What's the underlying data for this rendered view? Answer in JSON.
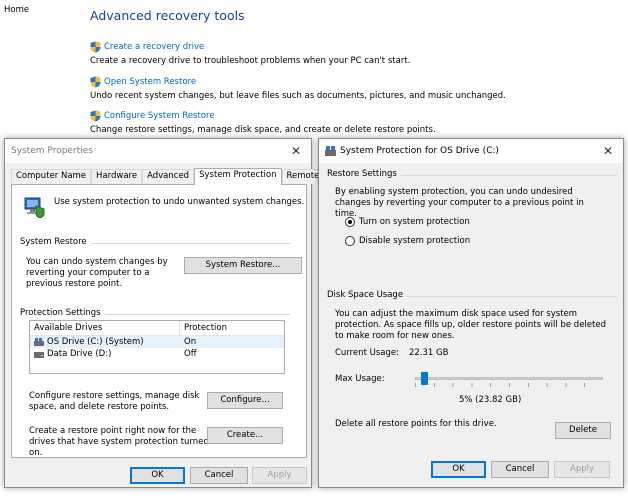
{
  "control_panel": {
    "home": "Home",
    "title": "Advanced recovery tools",
    "items": [
      {
        "link": "Create a recovery drive",
        "desc": "Create a recovery drive to troubleshoot problems when your PC can't start."
      },
      {
        "link": "Open System Restore",
        "desc": "Undo recent system changes, but leave files such as documents, pictures, and music unchanged."
      },
      {
        "link": "Configure System Restore",
        "desc": "Change restore settings, manage disk space, and create or delete restore points."
      }
    ]
  },
  "system_properties": {
    "title": "System Properties",
    "tabs": [
      "Computer Name",
      "Hardware",
      "Advanced",
      "System Protection",
      "Remote"
    ],
    "active_tab": "System Protection",
    "intro": "Use system protection to undo unwanted system changes.",
    "restore_group": "System Restore",
    "restore_text": "You can undo system changes by reverting your computer to a previous restore point.",
    "restore_button": "System Restore...",
    "protection_group": "Protection Settings",
    "columns": [
      "Available Drives",
      "Protection"
    ],
    "drives": [
      {
        "name": "OS Drive (C:) (System)",
        "protection": "On"
      },
      {
        "name": "Data Drive (D:)",
        "protection": "Off"
      }
    ],
    "configure_text": "Configure restore settings, manage disk space, and delete restore points.",
    "configure_button": "Configure...",
    "create_text": "Create a restore point right now for the drives that have system protection turned on.",
    "create_button": "Create...",
    "ok": "OK",
    "cancel": "Cancel",
    "apply": "Apply"
  },
  "system_protection": {
    "title": "System Protection for OS Drive (C:)",
    "restore_settings_group": "Restore Settings",
    "restore_settings_text": "By enabling system protection, you can undo undesired changes by reverting your computer to a previous point in time.",
    "radio_on": "Turn on system protection",
    "radio_off": "Disable system protection",
    "selected_radio": "on",
    "disk_group": "Disk Space Usage",
    "disk_text": "You can adjust the maximum disk space used for system protection. As space fills up, older restore points will be deleted to make room for new ones.",
    "current_usage_label": "Current Usage:",
    "current_usage_value": "22.31 GB",
    "max_usage_label": "Max Usage:",
    "max_usage_value": "5% (23.82 GB)",
    "max_usage_percent": 5,
    "delete_text": "Delete all restore points for this drive.",
    "delete_button": "Delete",
    "ok": "OK",
    "cancel": "Cancel",
    "apply": "Apply"
  },
  "icons": {
    "shield": "uac-shield-icon",
    "drive": "drive-icon",
    "system_protection": "system-protection-icon"
  },
  "colors": {
    "link": "#0066cc",
    "heading": "#1c3f94",
    "accent": "#0078d7",
    "dialog_bg": "#f0f0f0"
  }
}
